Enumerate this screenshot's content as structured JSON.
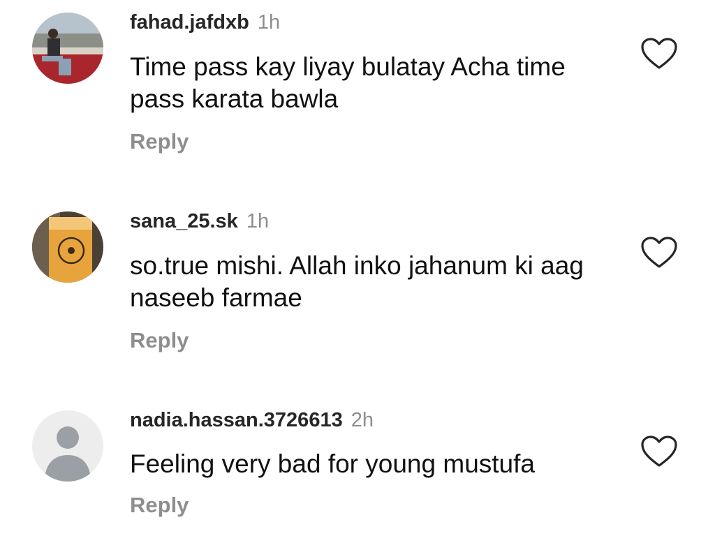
{
  "comments": [
    {
      "username": "fahad.jafdxb",
      "time": "1h",
      "text": "Time pass kay liyay bulatay Acha time pass karata bawla",
      "reply_label": "Reply",
      "avatar_icon": "profile-photo",
      "like_icon": "heart-outline-icon"
    },
    {
      "username": "sana_25.sk",
      "time": "1h",
      "text": "so.true mishi. Allah inko jahanum ki aag naseeb farmae",
      "reply_label": "Reply",
      "avatar_icon": "profile-photo",
      "like_icon": "heart-outline-icon"
    },
    {
      "username": "nadia.hassan.3726613",
      "time": "2h",
      "text": "Feeling very bad for young mustufa",
      "reply_label": "Reply",
      "avatar_icon": "default-avatar-icon",
      "like_icon": "heart-outline-icon"
    }
  ],
  "colors": {
    "username": "#262626",
    "meta": "#8e8e8e",
    "background": "#ffffff"
  }
}
